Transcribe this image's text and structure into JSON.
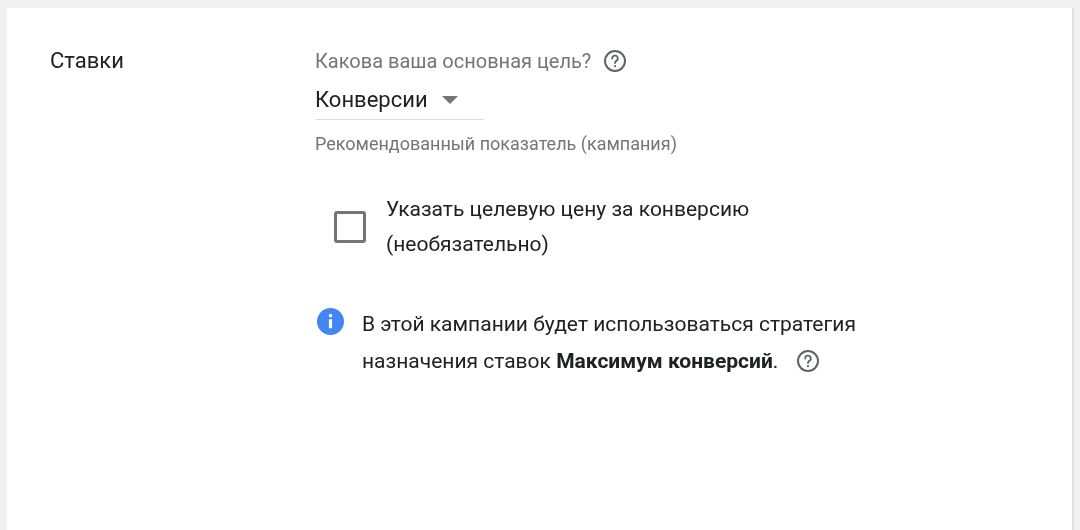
{
  "section": {
    "title": "Ставки"
  },
  "goal": {
    "question": "Какова ваша основная цель?",
    "value": "Конверсии",
    "hint": "Рекомендованный показатель (кампания)"
  },
  "target_cpa": {
    "label": "Указать целевую цену за конверсию (необязательно)",
    "checked": false
  },
  "info": {
    "text": "В этой кампании будет использоваться стратегия назначения ставок **Максимум конверсий**."
  }
}
